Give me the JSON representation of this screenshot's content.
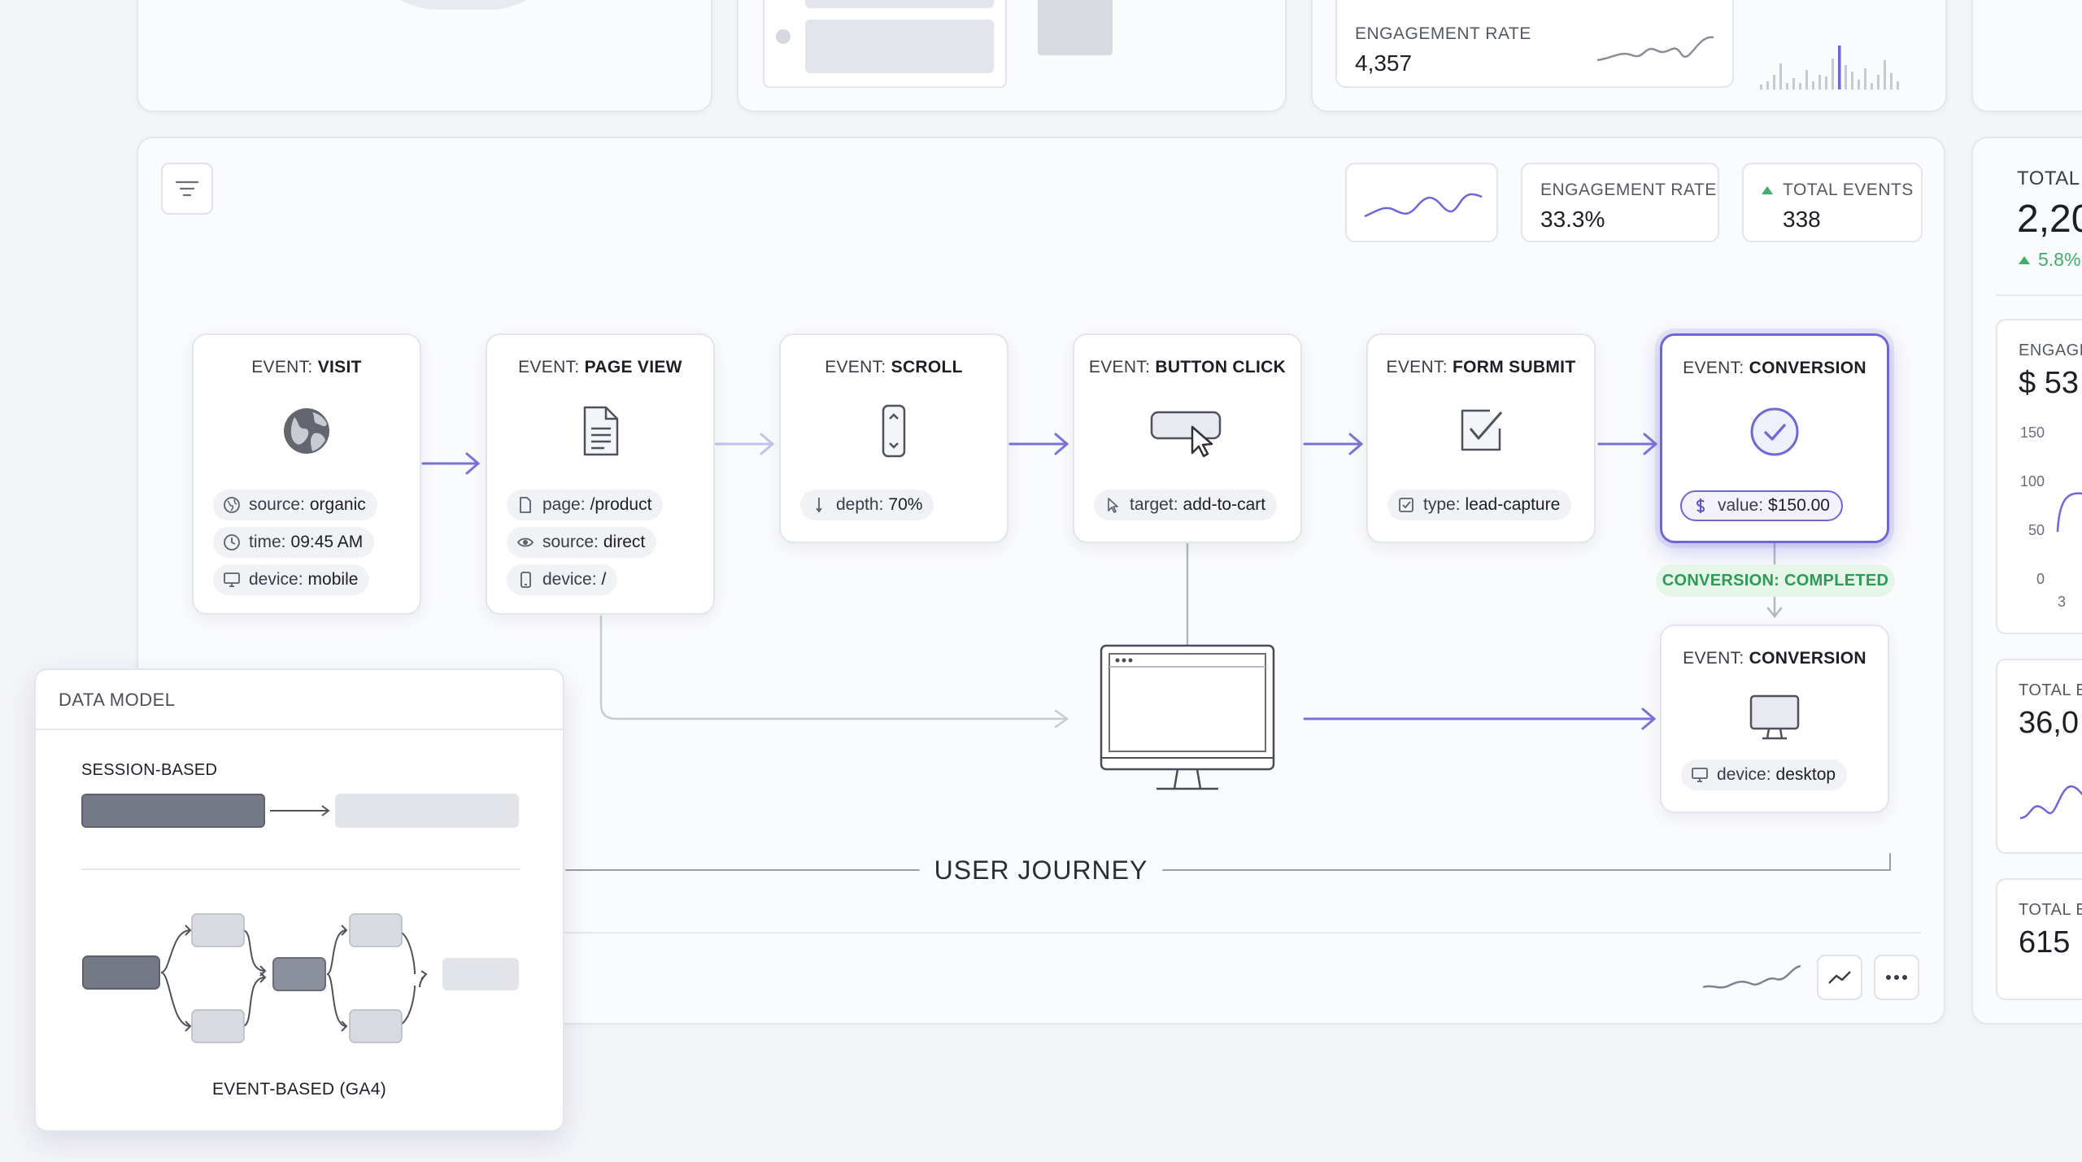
{
  "top_strip": {
    "engagement_label": "ENGAGEMENT RATE",
    "engagement_value": "4,357"
  },
  "toolbar": {
    "filter_icon": "filter-lines-icon",
    "engagement_label": "ENGAGEMENT RATE",
    "engagement_value": "33.3%",
    "total_events_label": "TOTAL EVENTS",
    "total_events_value": "338"
  },
  "events": [
    {
      "prefix": "EVENT:",
      "name": "VISIT",
      "icon": "globe-icon",
      "props": [
        {
          "icon": "globe-icon",
          "key": "source:",
          "value": "organic"
        },
        {
          "icon": "clock-icon",
          "key": "time:",
          "value": "09:45 AM"
        },
        {
          "icon": "monitor-icon",
          "key": "device:",
          "value": "mobile"
        }
      ]
    },
    {
      "prefix": "EVENT:",
      "name": "PAGE VIEW",
      "icon": "document-icon",
      "props": [
        {
          "icon": "file-icon",
          "key": "page:",
          "value": "/product"
        },
        {
          "icon": "eye-icon",
          "key": "source:",
          "value": "direct"
        },
        {
          "icon": "phone-icon",
          "key": "device:",
          "value": "/"
        }
      ]
    },
    {
      "prefix": "EVENT:",
      "name": "SCROLL",
      "icon": "scroll-icon",
      "props": [
        {
          "icon": "depth-icon",
          "key": "depth:",
          "value": "70%"
        }
      ]
    },
    {
      "prefix": "EVENT:",
      "name": "BUTTON CLICK",
      "icon": "button-cursor-icon",
      "props": [
        {
          "icon": "cursor-icon",
          "key": "target:",
          "value": "add-to-cart"
        }
      ]
    },
    {
      "prefix": "EVENT:",
      "name": "FORM SUBMIT",
      "icon": "checkbox-icon",
      "props": [
        {
          "icon": "check-square-icon",
          "key": "type:",
          "value": "lead-capture"
        }
      ]
    },
    {
      "prefix": "EVENT:",
      "name": "CONVERSION",
      "icon": "check-circle-icon",
      "props": [
        {
          "icon": "dollar-icon",
          "key": "value:",
          "value": "$150.00"
        }
      ]
    },
    {
      "prefix": "EVENT:",
      "name": "CONVERSION",
      "icon": "desktop-icon",
      "props": [
        {
          "icon": "monitor-icon",
          "key": "device:",
          "value": "desktop"
        }
      ]
    }
  ],
  "conversion_status": "CONVERSION: COMPLETED",
  "journey_label": "USER JOURNEY",
  "data_model": {
    "title": "DATA MODEL",
    "session_label": "SESSION-BASED",
    "event_label": "EVENT-BASED (GA4)"
  },
  "right_panel": {
    "total_label": "TOTAL",
    "total_value": "2,20",
    "total_delta": "5.8%",
    "engage_label": "ENGAGE",
    "engage_value": "$ 53",
    "y_ticks": [
      "150",
      "100",
      "50",
      "0"
    ],
    "x_tick": "3",
    "total2_label": "TOTAL E",
    "total2_value": "36,0",
    "total3_label": "TOTAL E",
    "total3_value": "615"
  },
  "colors": {
    "accent": "#6f66d8",
    "success": "#3fae6a",
    "success_bg": "#e4f6ea"
  }
}
